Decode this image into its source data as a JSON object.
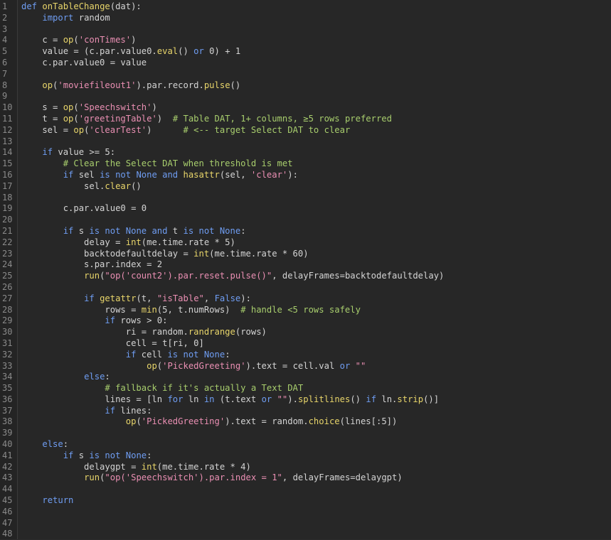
{
  "editor": {
    "lines": [
      {
        "n": "1",
        "t": [
          [
            "kw",
            "def "
          ],
          [
            "fn",
            "onTableChange"
          ],
          [
            "pl",
            "(dat):"
          ]
        ]
      },
      {
        "n": "2",
        "t": [
          [
            "pl",
            "    "
          ],
          [
            "kw",
            "import"
          ],
          [
            "pl",
            " random"
          ]
        ]
      },
      {
        "n": "3",
        "t": []
      },
      {
        "n": "4",
        "t": [
          [
            "pl",
            "    c = "
          ],
          [
            "bi",
            "op"
          ],
          [
            "pl",
            "("
          ],
          [
            "st",
            "'conTimes'"
          ],
          [
            "pl",
            ")"
          ]
        ]
      },
      {
        "n": "5",
        "t": [
          [
            "pl",
            "    value = (c.par.value0."
          ],
          [
            "bi",
            "eval"
          ],
          [
            "pl",
            "() "
          ],
          [
            "kw",
            "or"
          ],
          [
            "pl",
            " 0) + 1"
          ]
        ]
      },
      {
        "n": "6",
        "t": [
          [
            "pl",
            "    c.par.value0 = value"
          ]
        ]
      },
      {
        "n": "7",
        "t": []
      },
      {
        "n": "8",
        "t": [
          [
            "pl",
            "    "
          ],
          [
            "bi",
            "op"
          ],
          [
            "pl",
            "("
          ],
          [
            "st",
            "'moviefileout1'"
          ],
          [
            "pl",
            ").par.record."
          ],
          [
            "bi",
            "pulse"
          ],
          [
            "pl",
            "()"
          ]
        ]
      },
      {
        "n": "9",
        "t": []
      },
      {
        "n": "10",
        "t": [
          [
            "pl",
            "    s = "
          ],
          [
            "bi",
            "op"
          ],
          [
            "pl",
            "("
          ],
          [
            "st",
            "'Speechswitch'"
          ],
          [
            "pl",
            ")"
          ]
        ]
      },
      {
        "n": "11",
        "t": [
          [
            "pl",
            "    t = "
          ],
          [
            "bi",
            "op"
          ],
          [
            "pl",
            "("
          ],
          [
            "st",
            "'greetingTable'"
          ],
          [
            "pl",
            ")  "
          ],
          [
            "cm",
            "# Table DAT, 1+ columns, ≥5 rows preferred"
          ]
        ]
      },
      {
        "n": "12",
        "t": [
          [
            "pl",
            "    sel = "
          ],
          [
            "bi",
            "op"
          ],
          [
            "pl",
            "("
          ],
          [
            "st",
            "'clearTest'"
          ],
          [
            "pl",
            ")      "
          ],
          [
            "cm",
            "# <-- target Select DAT to clear"
          ]
        ]
      },
      {
        "n": "13",
        "t": []
      },
      {
        "n": "14",
        "t": [
          [
            "pl",
            "    "
          ],
          [
            "kw",
            "if"
          ],
          [
            "pl",
            " value >= 5:"
          ]
        ]
      },
      {
        "n": "15",
        "t": [
          [
            "pl",
            "        "
          ],
          [
            "cm",
            "# Clear the Select DAT when threshold is met"
          ]
        ]
      },
      {
        "n": "16",
        "t": [
          [
            "pl",
            "        "
          ],
          [
            "kw",
            "if"
          ],
          [
            "pl",
            " sel "
          ],
          [
            "kw",
            "is not None and "
          ],
          [
            "bi",
            "hasattr"
          ],
          [
            "pl",
            "(sel, "
          ],
          [
            "st",
            "'clear'"
          ],
          [
            "pl",
            "):"
          ]
        ]
      },
      {
        "n": "17",
        "t": [
          [
            "pl",
            "            sel."
          ],
          [
            "bi",
            "clear"
          ],
          [
            "pl",
            "()"
          ]
        ]
      },
      {
        "n": "18",
        "t": []
      },
      {
        "n": "19",
        "t": [
          [
            "pl",
            "        c.par.value0 = 0"
          ]
        ]
      },
      {
        "n": "20",
        "t": []
      },
      {
        "n": "21",
        "t": [
          [
            "pl",
            "        "
          ],
          [
            "kw",
            "if"
          ],
          [
            "pl",
            " s "
          ],
          [
            "kw",
            "is not None and"
          ],
          [
            "pl",
            " t "
          ],
          [
            "kw",
            "is not None"
          ],
          [
            "pl",
            ":"
          ]
        ]
      },
      {
        "n": "22",
        "t": [
          [
            "pl",
            "            delay = "
          ],
          [
            "bi",
            "int"
          ],
          [
            "pl",
            "(me.time.rate * 5)"
          ]
        ]
      },
      {
        "n": "23",
        "t": [
          [
            "pl",
            "            backtodefaultdelay = "
          ],
          [
            "bi",
            "int"
          ],
          [
            "pl",
            "(me.time.rate * 60)"
          ]
        ]
      },
      {
        "n": "24",
        "t": [
          [
            "pl",
            "            s.par.index = 2"
          ]
        ]
      },
      {
        "n": "25",
        "t": [
          [
            "pl",
            "            "
          ],
          [
            "bi",
            "run"
          ],
          [
            "pl",
            "("
          ],
          [
            "st",
            "\"op('count2').par.reset.pulse()\""
          ],
          [
            "pl",
            ", delayFrames=backtodefaultdelay)"
          ]
        ]
      },
      {
        "n": "26",
        "t": []
      },
      {
        "n": "27",
        "t": [
          [
            "pl",
            "            "
          ],
          [
            "kw",
            "if"
          ],
          [
            "pl",
            " "
          ],
          [
            "bi",
            "getattr"
          ],
          [
            "pl",
            "(t, "
          ],
          [
            "st",
            "\"isTable\""
          ],
          [
            "pl",
            ", "
          ],
          [
            "kw",
            "False"
          ],
          [
            "pl",
            "):"
          ]
        ]
      },
      {
        "n": "28",
        "t": [
          [
            "pl",
            "                rows = "
          ],
          [
            "bi",
            "min"
          ],
          [
            "pl",
            "(5, t.numRows)  "
          ],
          [
            "cm",
            "# handle <5 rows safely"
          ]
        ]
      },
      {
        "n": "29",
        "t": [
          [
            "pl",
            "                "
          ],
          [
            "kw",
            "if"
          ],
          [
            "pl",
            " rows > 0:"
          ]
        ]
      },
      {
        "n": "30",
        "t": [
          [
            "pl",
            "                    ri = random."
          ],
          [
            "bi",
            "randrange"
          ],
          [
            "pl",
            "(rows)"
          ]
        ]
      },
      {
        "n": "31",
        "t": [
          [
            "pl",
            "                    cell = t[ri, 0]"
          ]
        ]
      },
      {
        "n": "32",
        "t": [
          [
            "pl",
            "                    "
          ],
          [
            "kw",
            "if"
          ],
          [
            "pl",
            " cell "
          ],
          [
            "kw",
            "is not None"
          ],
          [
            "pl",
            ":"
          ]
        ]
      },
      {
        "n": "33",
        "t": [
          [
            "pl",
            "                        "
          ],
          [
            "bi",
            "op"
          ],
          [
            "pl",
            "("
          ],
          [
            "st",
            "'PickedGreeting'"
          ],
          [
            "pl",
            ").text = cell.val "
          ],
          [
            "kw",
            "or"
          ],
          [
            "pl",
            " "
          ],
          [
            "st",
            "\"\""
          ]
        ]
      },
      {
        "n": "34",
        "t": [
          [
            "pl",
            "            "
          ],
          [
            "kw",
            "else"
          ],
          [
            "pl",
            ":"
          ]
        ]
      },
      {
        "n": "35",
        "t": [
          [
            "pl",
            "                "
          ],
          [
            "cm",
            "# fallback if it's actually a Text DAT"
          ]
        ]
      },
      {
        "n": "36",
        "t": [
          [
            "pl",
            "                lines = [ln "
          ],
          [
            "kw",
            "for"
          ],
          [
            "pl",
            " ln "
          ],
          [
            "kw",
            "in"
          ],
          [
            "pl",
            " (t.text "
          ],
          [
            "kw",
            "or"
          ],
          [
            "pl",
            " "
          ],
          [
            "st",
            "\"\""
          ],
          [
            "pl",
            ")."
          ],
          [
            "bi",
            "splitlines"
          ],
          [
            "pl",
            "() "
          ],
          [
            "kw",
            "if"
          ],
          [
            "pl",
            " ln."
          ],
          [
            "bi",
            "strip"
          ],
          [
            "pl",
            "()]"
          ]
        ]
      },
      {
        "n": "37",
        "t": [
          [
            "pl",
            "                "
          ],
          [
            "kw",
            "if"
          ],
          [
            "pl",
            " lines:"
          ]
        ]
      },
      {
        "n": "38",
        "t": [
          [
            "pl",
            "                    "
          ],
          [
            "bi",
            "op"
          ],
          [
            "pl",
            "("
          ],
          [
            "st",
            "'PickedGreeting'"
          ],
          [
            "pl",
            ").text = random."
          ],
          [
            "bi",
            "choice"
          ],
          [
            "pl",
            "(lines[:5])"
          ]
        ]
      },
      {
        "n": "39",
        "t": []
      },
      {
        "n": "40",
        "t": [
          [
            "pl",
            "    "
          ],
          [
            "kw",
            "else"
          ],
          [
            "pl",
            ":"
          ]
        ]
      },
      {
        "n": "41",
        "t": [
          [
            "pl",
            "        "
          ],
          [
            "kw",
            "if"
          ],
          [
            "pl",
            " s "
          ],
          [
            "kw",
            "is not None"
          ],
          [
            "pl",
            ":"
          ]
        ]
      },
      {
        "n": "42",
        "t": [
          [
            "pl",
            "            delaygpt = "
          ],
          [
            "bi",
            "int"
          ],
          [
            "pl",
            "(me.time.rate * 4)"
          ]
        ]
      },
      {
        "n": "43",
        "t": [
          [
            "pl",
            "            "
          ],
          [
            "bi",
            "run"
          ],
          [
            "pl",
            "("
          ],
          [
            "st",
            "\"op('Speechswitch').par.index = 1\""
          ],
          [
            "pl",
            ", delayFrames=delaygpt)"
          ]
        ]
      },
      {
        "n": "44",
        "t": []
      },
      {
        "n": "45",
        "t": [
          [
            "pl",
            "    "
          ],
          [
            "kw",
            "return"
          ]
        ]
      },
      {
        "n": "46",
        "t": []
      },
      {
        "n": "47",
        "t": []
      },
      {
        "n": "48",
        "t": []
      }
    ]
  }
}
